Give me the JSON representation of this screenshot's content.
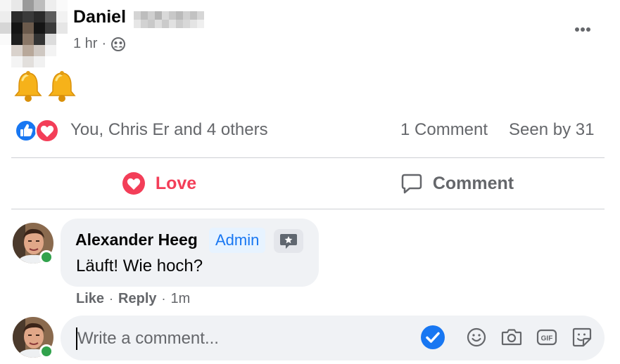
{
  "post": {
    "author_name": "Daniel",
    "time": "1 hr",
    "separator": "·",
    "audience_icon": "friends-icon",
    "more_icon": "more-horizontal-icon",
    "body_emoji": [
      "🔔",
      "🔔"
    ]
  },
  "reactions": {
    "icons": [
      "like-reaction-icon",
      "love-reaction-icon"
    ],
    "names": "You, Chris Er and 4 others",
    "comment_count": "1 Comment",
    "seen_by": "Seen by 31"
  },
  "actions": {
    "love_label": "Love",
    "comment_label": "Comment"
  },
  "comment": {
    "author": "Alexander Heeg",
    "badge": "Admin",
    "badge_icon": "star-message-icon",
    "text": "Läuft! Wie hoch?",
    "like_label": "Like",
    "reply_label": "Reply",
    "time": "1m",
    "separator": "·"
  },
  "composer": {
    "placeholder": "Write a comment...",
    "icons": [
      "checkmark-icon",
      "emoji-icon",
      "camera-icon",
      "gif-icon",
      "sticker-icon"
    ]
  },
  "colors": {
    "love": "#f33e58",
    "like_blue": "#1877f2",
    "secondary_text": "#65676b",
    "bubble_bg": "#f0f2f5",
    "online_green": "#31a24c"
  }
}
